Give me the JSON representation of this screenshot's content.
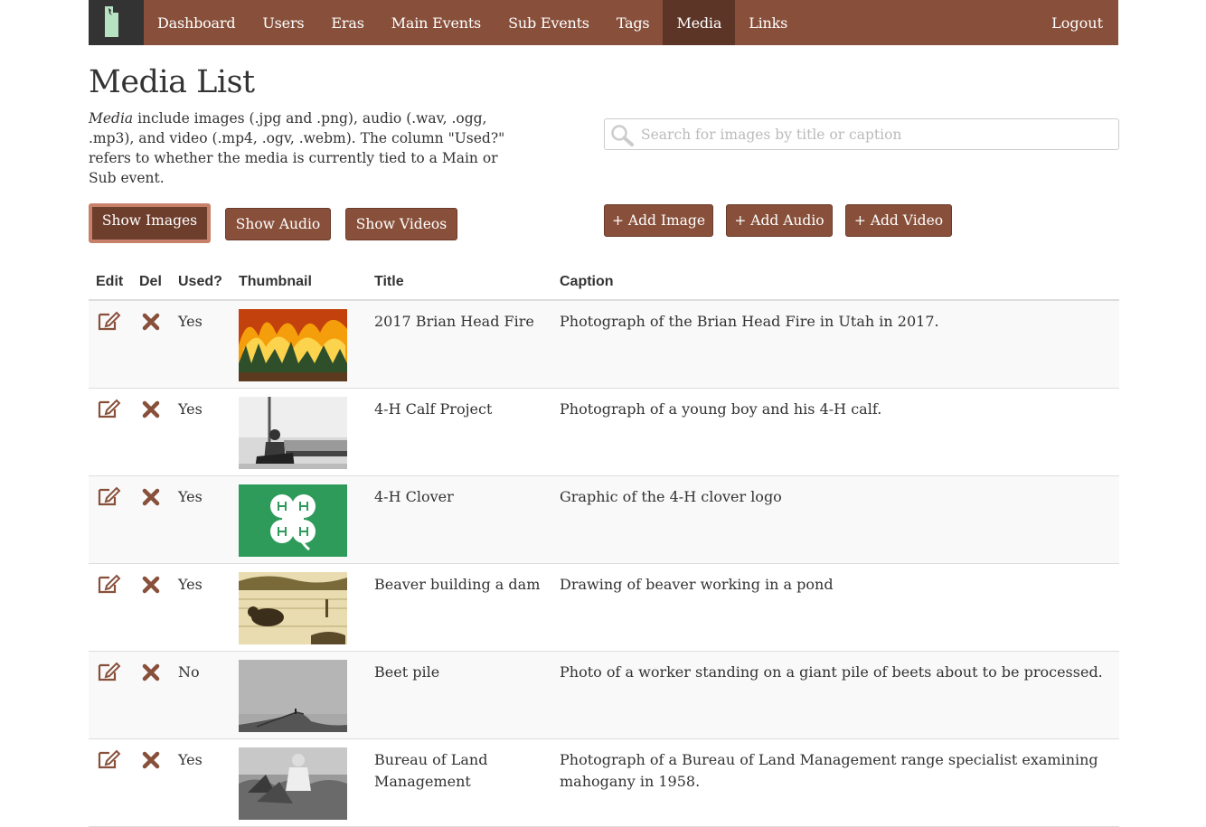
{
  "nav": {
    "items": [
      {
        "label": "Dashboard",
        "active": false
      },
      {
        "label": "Users",
        "active": false
      },
      {
        "label": "Eras",
        "active": false
      },
      {
        "label": "Main Events",
        "active": false
      },
      {
        "label": "Sub Events",
        "active": false
      },
      {
        "label": "Tags",
        "active": false
      },
      {
        "label": "Media",
        "active": true
      },
      {
        "label": "Links",
        "active": false
      }
    ],
    "logout_label": "Logout",
    "brand_icon": "utah-state-logo"
  },
  "page": {
    "title": "Media List",
    "intro_em": "Media",
    "intro_rest": " include images (.jpg and .png), audio (.wav, .ogg, .mp3), and video (.mp4, .ogv, .webm). The column \"Used?\" refers to whether the media is currently tied to a Main or Sub event."
  },
  "search": {
    "placeholder": "Search for images by title or caption",
    "value": ""
  },
  "filter_buttons": {
    "images": "Show Images",
    "audio": "Show Audio",
    "videos": "Show Videos",
    "selected": "images"
  },
  "add_buttons": {
    "image": "+ Add Image",
    "audio": "+ Add Audio",
    "video": "+ Add Video"
  },
  "table": {
    "headers": {
      "edit": "Edit",
      "del": "Del",
      "used": "Used?",
      "thumbnail": "Thumbnail",
      "title": "Title",
      "caption": "Caption"
    },
    "rows": [
      {
        "used": "Yes",
        "title": "2017 Brian Head Fire",
        "caption": "Photograph of the Brian Head Fire in Utah in 2017.",
        "thumb": "forest-fire-photo"
      },
      {
        "used": "Yes",
        "title": "4-H Calf Project",
        "caption": "Photograph of a young boy and his 4-H calf.",
        "thumb": "boy-with-calf-photo"
      },
      {
        "used": "Yes",
        "title": "4-H Clover",
        "caption": "Graphic of the 4-H clover logo",
        "thumb": "4h-clover-logo"
      },
      {
        "used": "Yes",
        "title": "Beaver building a dam",
        "caption": "Drawing of beaver working in a pond",
        "thumb": "beaver-drawing"
      },
      {
        "used": "No",
        "title": "Beet pile",
        "caption": "Photo of a worker standing on a giant pile of beets about to be processed.",
        "thumb": "beet-pile-photo"
      },
      {
        "used": "Yes",
        "title": "Bureau of Land Management",
        "caption": "Photograph of a Bureau of Land Management range specialist examining mahogany in 1958.",
        "thumb": "blm-specialist-photo"
      }
    ]
  },
  "colors": {
    "brand": "#88503b",
    "brand_dark": "#5c3526",
    "brand_icon_bg": "#333333",
    "icon_color": "#88503b"
  }
}
